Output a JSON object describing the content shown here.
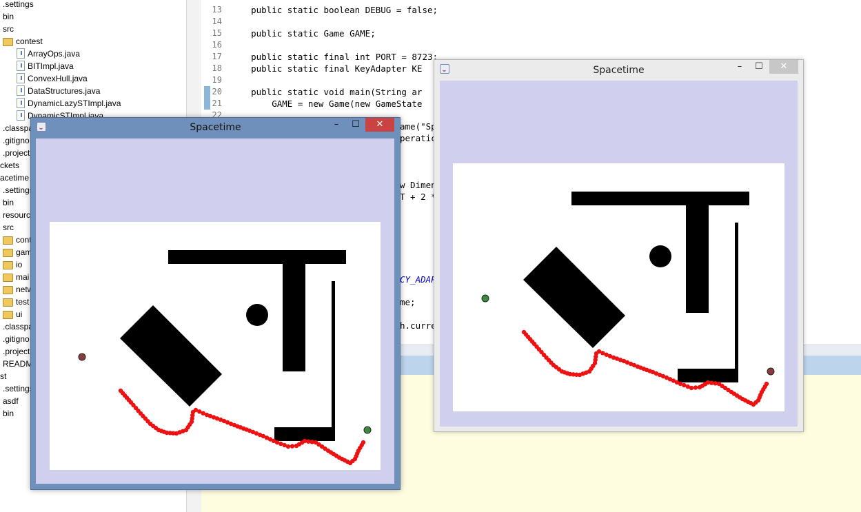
{
  "explorer": {
    "items": [
      {
        "label": ".settings",
        "kind": "folder-plain"
      },
      {
        "label": "bin",
        "kind": "folder-plain"
      },
      {
        "label": "src",
        "kind": "folder-plain"
      },
      {
        "label": "contest",
        "kind": "folder"
      },
      {
        "label": "ArrayOps.java",
        "kind": "file"
      },
      {
        "label": "BITImpl.java",
        "kind": "file"
      },
      {
        "label": "ConvexHull.java",
        "kind": "file"
      },
      {
        "label": "DataStructures.java",
        "kind": "file"
      },
      {
        "label": "DynamicLazySTImpl.java",
        "kind": "file"
      },
      {
        "label": "DynamicSTImpl.java",
        "kind": "file"
      },
      {
        "label": ".classpa",
        "kind": "plain"
      },
      {
        "label": ".gitigno",
        "kind": "plain"
      },
      {
        "label": ".project",
        "kind": "plain"
      },
      {
        "label": "ckets",
        "kind": "plain"
      },
      {
        "label": "acetime",
        "kind": "plain"
      },
      {
        "label": ".settings",
        "kind": "plain"
      },
      {
        "label": "bin",
        "kind": "plain"
      },
      {
        "label": "resourc",
        "kind": "plain"
      },
      {
        "label": "src",
        "kind": "plain"
      },
      {
        "label": "cont",
        "kind": "folder"
      },
      {
        "label": "gam",
        "kind": "folder"
      },
      {
        "label": "io",
        "kind": "folder"
      },
      {
        "label": "mai",
        "kind": "folder"
      },
      {
        "label": "netw",
        "kind": "folder"
      },
      {
        "label": "test",
        "kind": "folder"
      },
      {
        "label": "ui",
        "kind": "folder"
      },
      {
        "label": ".classpa",
        "kind": "plain"
      },
      {
        "label": ".gitigno",
        "kind": "plain"
      },
      {
        "label": ".project",
        "kind": "plain"
      },
      {
        "label": "READM",
        "kind": "plain"
      },
      {
        "label": "st",
        "kind": "plain"
      },
      {
        "label": ".settings",
        "kind": "plain"
      },
      {
        "label": "asdf",
        "kind": "plain"
      },
      {
        "label": "bin",
        "kind": "plain"
      }
    ]
  },
  "editor": {
    "lines": [
      {
        "num": "13",
        "code": "    public static boolean DEBUG = false;"
      },
      {
        "num": "14",
        "code": ""
      },
      {
        "num": "15",
        "code": "    public static Game GAME;"
      },
      {
        "num": "16",
        "code": ""
      },
      {
        "num": "17",
        "code": "    public static final int PORT = 8723;"
      },
      {
        "num": "18",
        "code": "    public static final KeyAdapter KE"
      },
      {
        "num": "19",
        "code": ""
      },
      {
        "num": "20",
        "code": "    public static void main(String ar"
      },
      {
        "num": "21",
        "code": "        GAME = new Game(new GameState"
      },
      {
        "num": "22",
        "code": ""
      }
    ],
    "fragments": [
      {
        "text": "ame(\"Sp"
      },
      {
        "text": "peratic"
      },
      {
        "text": "w Dimen"
      },
      {
        "text": "T + 2 *"
      },
      {
        "text": "CY_ADAP"
      },
      {
        "text": "me;"
      },
      {
        "text": "h.curre"
      }
    ]
  },
  "windows": {
    "left": {
      "title": "Spacetime",
      "minimize": "–",
      "maximize": "☐",
      "close": "✕"
    },
    "right": {
      "title": "Spacetime",
      "minimize": "–",
      "maximize": "☐",
      "close": "✕"
    }
  },
  "colors": {
    "trail": "#ee1111",
    "client_bg": "#d0d0ee",
    "left_frame": "#6e90ba",
    "right_frame": "#ebebeb",
    "close_red": "#c94343"
  },
  "icons": {
    "folder": "folder-icon",
    "file": "java-file-icon",
    "window": "java-app-icon"
  }
}
